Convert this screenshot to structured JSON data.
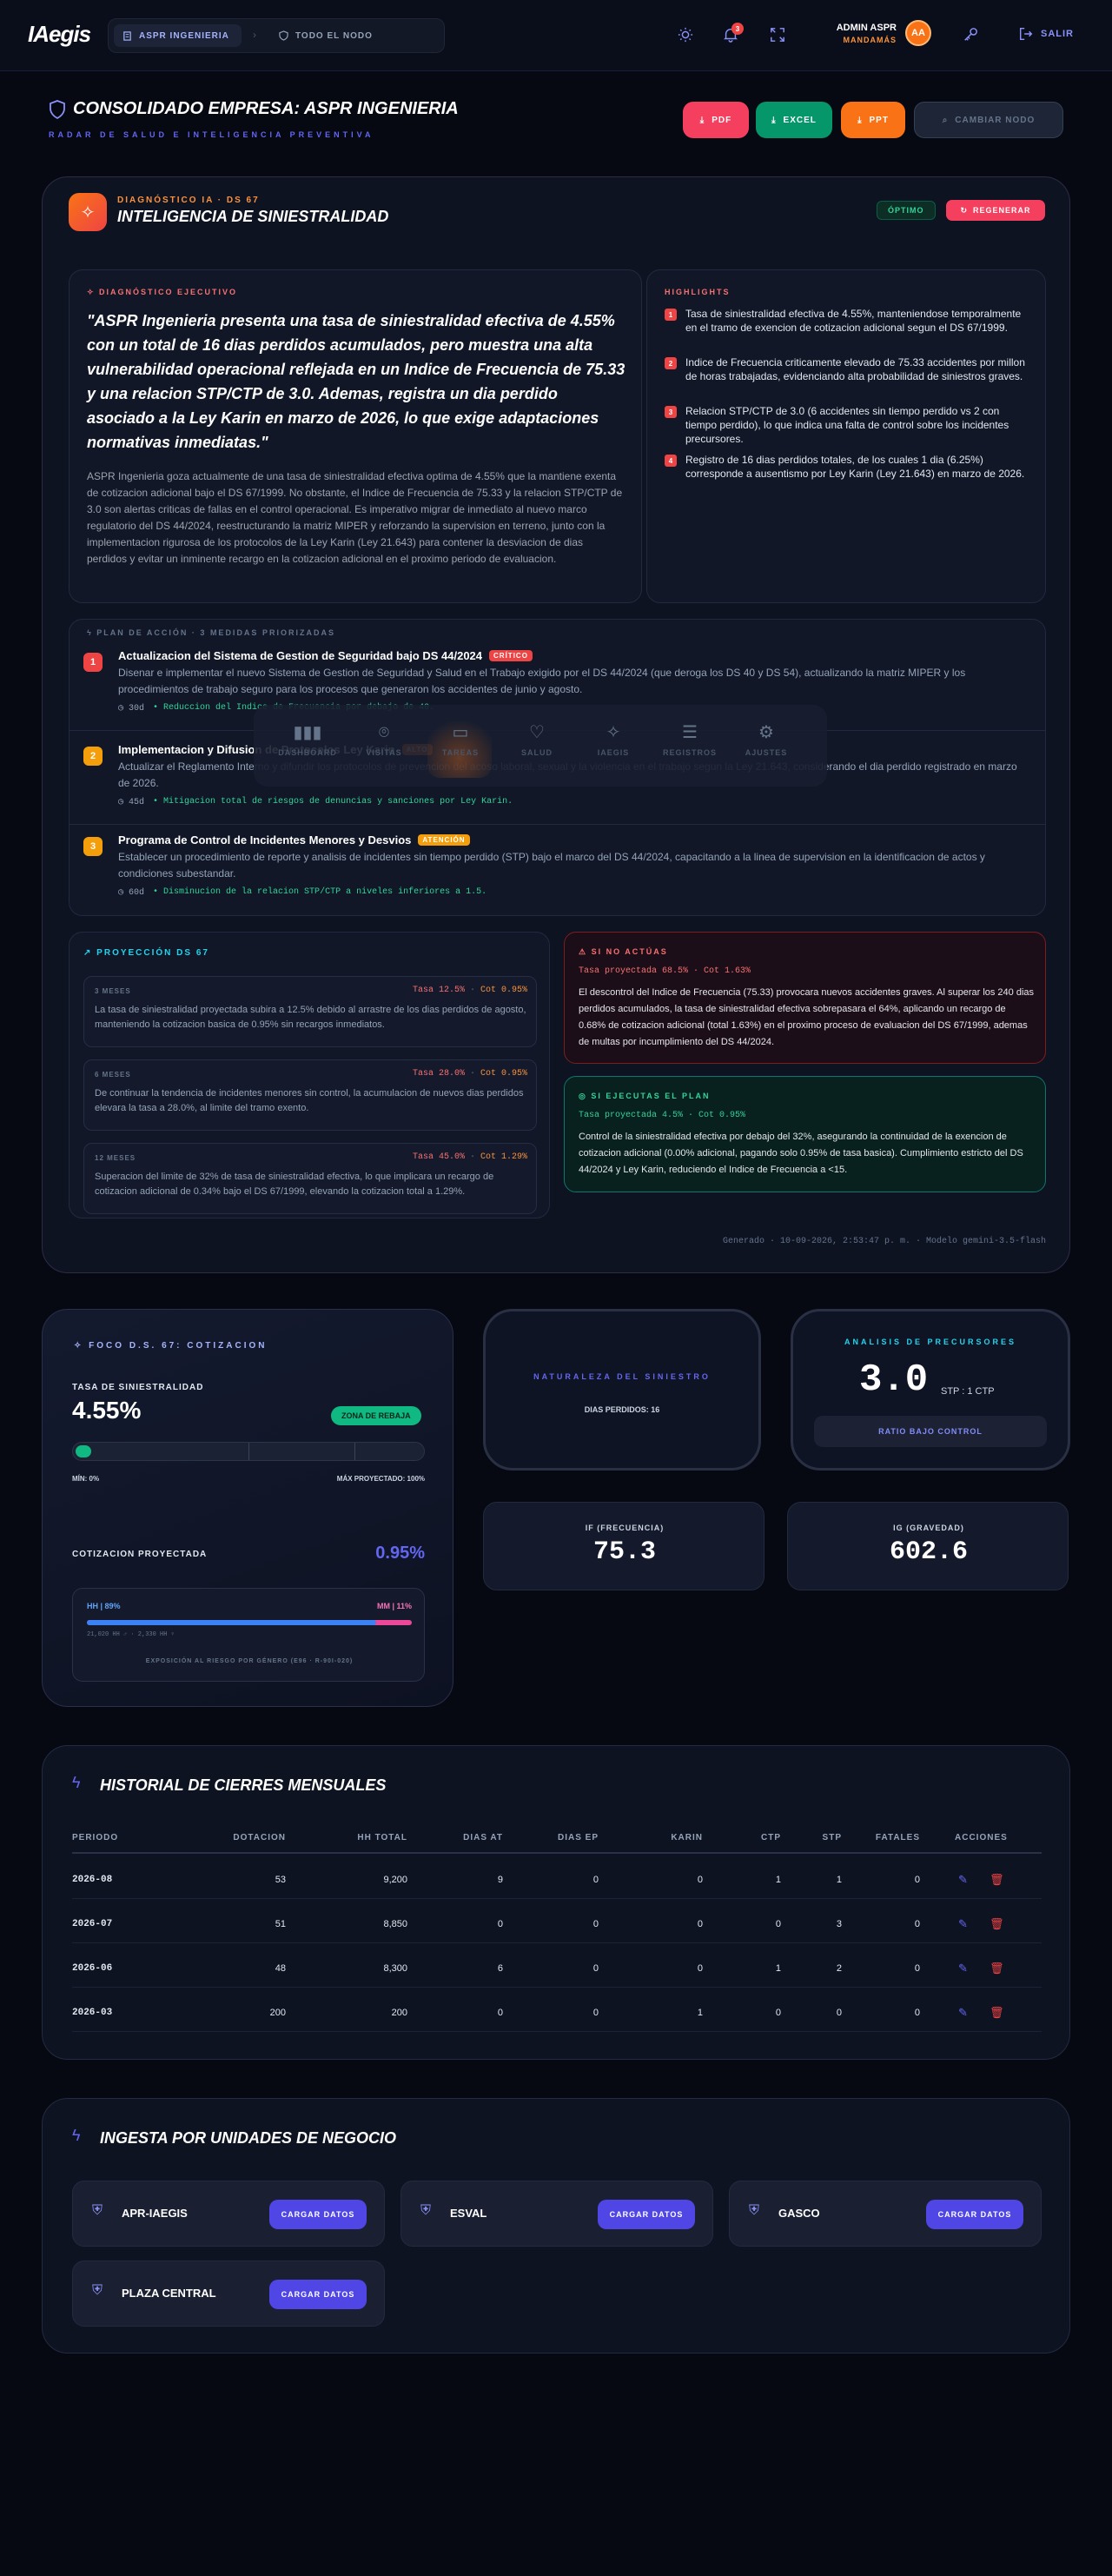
{
  "header": {
    "logo": "IAegis",
    "crumb_active": "ASPR INGENIERIA",
    "crumb_other": "TODO EL NODO",
    "notif_count": "3",
    "user_name": "ADMIN ASPR",
    "user_role": "MANDAMÁS",
    "avatar": "AA",
    "logout": "SALIR"
  },
  "page": {
    "title": "CONSOLIDADO EMPRESA: ASPR INGENIERIA",
    "subtitle": "RADAR DE SALUD E INTELIGENCIA PREVENTIVA"
  },
  "actions": {
    "pdf": "PDF",
    "excel": "EXCEL",
    "ppt": "PPT",
    "switch": "CAMBIAR NODO"
  },
  "ai": {
    "kicker": "DIAGNÓSTICO IA · DS 67",
    "title": "INTELIGENCIA DE SINIESTRALIDAD",
    "status": "ÓPTIMO",
    "regen": "REGENERAR",
    "exec_label": "DIAGNÓSTICO EJECUTIVO",
    "quote": "\"ASPR Ingenieria presenta una tasa de siniestralidad efectiva de 4.55% con un total de 16 dias perdidos acumulados, pero muestra una alta vulnerabilidad operacional reflejada en un Indice de Frecuencia de 75.33 y una relacion STP/CTP de 3.0. Ademas, registra un dia perdido asociado a la Ley Karin en marzo de 2026, lo que exige adaptaciones normativas inmediatas.\"",
    "body": "ASPR Ingenieria goza actualmente de una tasa de siniestralidad efectiva optima de 4.55% que la mantiene exenta de cotizacion adicional bajo el DS 67/1999. No obstante, el Indice de Frecuencia de 75.33 y la relacion STP/CTP de 3.0 son alertas criticas de fallas en el control operacional. Es imperativo migrar de inmediato al nuevo marco regulatorio del DS 44/2024, reestructurando la matriz MIPER y reforzando la supervision en terreno, junto con la implementacion rigurosa de los protocolos de la Ley Karin (Ley 21.643) para contener la desviacion de dias perdidos y evitar un inminente recargo en la cotizacion adicional en el proximo periodo de evaluacion.",
    "highlights_label": "HIGHLIGHTS",
    "highlights": [
      {
        "n": "1",
        "text": "Tasa de siniestralidad efectiva de 4.55%, manteniendose temporalmente en el tramo de exencion de cotizacion adicional segun el DS 67/1999."
      },
      {
        "n": "2",
        "text": "Indice de Frecuencia criticamente elevado de 75.33 accidentes por millon de horas trabajadas, evidenciando alta probabilidad de siniestros graves."
      },
      {
        "n": "3",
        "text": "Relacion STP/CTP de 3.0 (6 accidentes sin tiempo perdido vs 2 con tiempo perdido), lo que indica una falta de control sobre los incidentes precursores."
      },
      {
        "n": "4",
        "text": "Registro de 16 dias perdidos totales, de los cuales 1 dia (6.25%) corresponde a ausentismo por Ley Karin (Ley 21.643) en marzo de 2026."
      }
    ],
    "plan_label": "PLAN DE ACCIÓN · 3 MEDIDAS PRIORIZADAS",
    "plan": [
      {
        "n": "1",
        "title": "Actualizacion del Sistema de Gestion de Seguridad bajo DS 44/2024",
        "tag": "CRÍTICO",
        "desc": "Disenar e implementar el nuevo Sistema de Gestion de Seguridad y Salud en el Trabajo exigido por el DS 44/2024 (que deroga los DS 40 y DS 54), actualizando la matriz MIPER y los procedimientos de trabajo seguro para los procesos que generaron los accidentes de junio y agosto.",
        "days": "30d",
        "impact": "• Reduccion del Indice de Frecuencia por debajo de 40."
      },
      {
        "n": "2",
        "title": "Implementacion y Difusion de Protocolos Ley Karin",
        "tag": "ALTO",
        "desc": "Actualizar el Reglamento Interno y difundir los protocolos de prevencion del acoso laboral, sexual y la violencia en el trabajo segun la Ley 21.643, considerando el dia perdido registrado en marzo de 2026.",
        "days": "45d",
        "impact": "• Mitigacion total de riesgos de denuncias y sanciones por Ley Karin."
      },
      {
        "n": "3",
        "title": "Programa de Control de Incidentes Menores y Desvios",
        "tag": "ATENCIÓN",
        "desc": "Establecer un procedimiento de reporte y analisis de incidentes sin tiempo perdido (STP) bajo el marco del DS 44/2024, capacitando a la linea de supervision en la identificacion de actos y condiciones subestandar.",
        "days": "60d",
        "impact": "• Disminucion de la relacion STP/CTP a niveles inferiores a 1.5."
      }
    ],
    "dock": [
      "DASHBOARD",
      "VISITAS",
      "TAREAS",
      "SALUD",
      "IAEGIS",
      "REGISTROS",
      "AJUSTES"
    ],
    "projection_label": "PROYECCIÓN DS 67",
    "projections": [
      {
        "period": "3 MESES",
        "rate": "Tasa 12.5%",
        "cot": "Cot 0.95%",
        "text": "La tasa de siniestralidad proyectada subira a 12.5% debido al arrastre de los dias perdidos de agosto, manteniendo la cotizacion basica de 0.95% sin recargos inmediatos."
      },
      {
        "period": "6 MESES",
        "rate": "Tasa 28.0%",
        "cot": "Cot 0.95%",
        "text": "De continuar la tendencia de incidentes menores sin control, la acumulacion de nuevos dias perdidos elevara la tasa a 28.0%, al limite del tramo exento."
      },
      {
        "period": "12 MESES",
        "rate": "Tasa 45.0%",
        "cot": "Cot 1.29%",
        "text": "Superacion del limite de 32% de tasa de siniestralidad efectiva, lo que implicara un recargo de cotizacion adicional de 0.34% bajo el DS 67/1999, elevando la cotizacion total a 1.29%."
      }
    ],
    "risk_label": "SI NO ACTÚAS",
    "risk_sub": "Tasa proyectada 68.5% · Cot 1.63%",
    "risk_text": "El descontrol del Indice de Frecuencia (75.33) provocara nuevos accidentes graves. Al superar los 240 dias perdidos acumulados, la tasa de siniestralidad efectiva sobrepasara el 64%, aplicando un recargo de 0.68% de cotizacion adicional (total 1.63%) en el proximo proceso de evaluacion del DS 67/1999, ademas de multas por incumplimiento del DS 44/2024.",
    "plan_ok_label": "SI EJECUTAS EL PLAN",
    "plan_ok_sub": "Tasa proyectada 4.5% · Cot 0.95%",
    "plan_ok_text": "Control de la siniestralidad efectiva por debajo del 32%, asegurando la continuidad de la exencion de cotizacion adicional (0.00% adicional, pagando solo 0.95% de tasa basica). Cumplimiento estricto del DS 44/2024 y Ley Karin, reduciendo el Indice de Frecuencia a <15.",
    "footer": "Generado · 10-09-2026, 2:53:47 p. m. · Modelo gemini-3.5-flash"
  },
  "ds67": {
    "label": "FOCO D.S. 67: COTIZACION",
    "rate_label": "TASA DE SINIESTRALIDAD",
    "rate": "4.55%",
    "rate_value": 4.55,
    "rate_max": 100,
    "zone": "ZONA DE REBAJA",
    "min": "MÍN: 0%",
    "max": "MÁX PROYECTADO: 100%",
    "cot_label": "COTIZACION PROYECTADA",
    "cot": "0.95%",
    "hm_label": "HH | 89%",
    "hm_pct": 89,
    "mm_label": "MM | 11%",
    "hh_detail": "21,020 HH ♂ · 2,330 HH ♀",
    "gender_note": "EXPOSICIÓN AL RIESGO POR GÉNERO (E96 · R-90I-020)"
  },
  "nature": {
    "label": "NATURALEZA DEL SINIESTRO",
    "sub": "DIAS PERDIDOS: 16"
  },
  "precursor": {
    "label": "ANALISIS DE PRECURSORES",
    "value": "3.0",
    "unit": "STP : 1 CTP",
    "status": "RATIO BAJO CONTROL"
  },
  "if": {
    "label": "IF (FRECUENCIA)",
    "value": "75.3"
  },
  "ig": {
    "label": "IG (GRAVEDAD)",
    "value": "602.6"
  },
  "history": {
    "title": "HISTORIAL DE CIERRES MENSUALES",
    "columns": [
      "PERIODO",
      "DOTACION",
      "HH TOTAL",
      "DIAS AT",
      "DIAS EP",
      "KARIN",
      "CTP",
      "STP",
      "FATALES",
      "ACCIONES"
    ],
    "rows": [
      [
        "2026-08",
        "53",
        "9,200",
        "9",
        "0",
        "0",
        "1",
        "1",
        "0"
      ],
      [
        "2026-07",
        "51",
        "8,850",
        "0",
        "0",
        "0",
        "0",
        "3",
        "0"
      ],
      [
        "2026-06",
        "48",
        "8,300",
        "6",
        "0",
        "0",
        "1",
        "2",
        "0"
      ],
      [
        "2026-03",
        "200",
        "200",
        "0",
        "0",
        "1",
        "0",
        "0",
        "0"
      ]
    ]
  },
  "ingest": {
    "title": "INGESTA POR UNIDADES DE NEGOCIO",
    "button": "CARGAR DATOS",
    "units": [
      "APR-IAEGIS",
      "ESVAL",
      "GASCO",
      "PLAZA CENTRAL"
    ]
  },
  "colors": {
    "accent": "#6366f1",
    "danger": "#ef4444",
    "success": "#059669",
    "warning": "#f97316"
  }
}
